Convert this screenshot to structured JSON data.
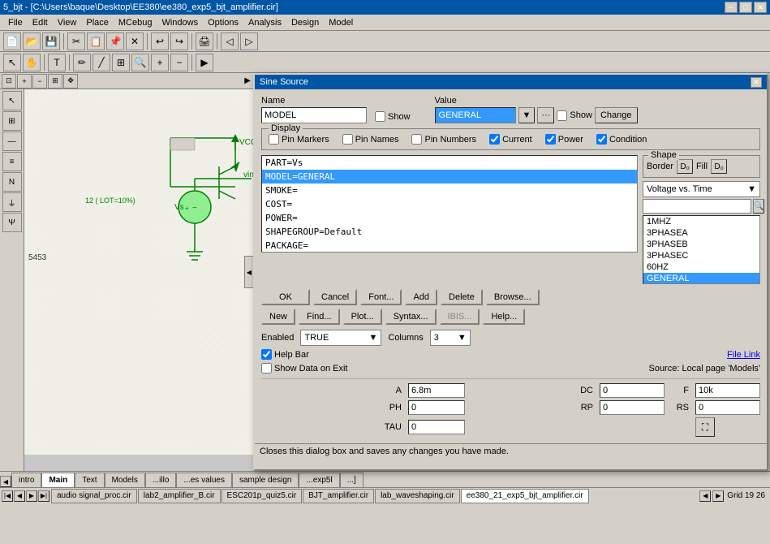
{
  "titleBar": {
    "text": "5_bjt - [C:\\Users\\baque\\Desktop\\EE380\\ee380_exp5_bjt_amplifier.cir]",
    "closeBtn": "✕",
    "minBtn": "−",
    "maxBtn": "□"
  },
  "menuBar": {
    "items": [
      "File",
      "Edit",
      "View",
      "Place",
      "MCebug",
      "Windows",
      "Options",
      "Analysis",
      "Design",
      "Model"
    ]
  },
  "dialog": {
    "title": "Sine Source",
    "name": {
      "label": "Name",
      "value": "MODEL"
    },
    "value": {
      "label": "Value",
      "value": "GENERAL",
      "showCheck": "Show",
      "changeBtn": "Change"
    },
    "display": {
      "legend": "Display",
      "options": [
        "Pin Markers",
        "Pin Names",
        "Pin Numbers",
        "Current",
        "Power",
        "Condition"
      ]
    },
    "shape": {
      "legend": "Shape",
      "borderLabel": "Border",
      "fillLabel": "Fill"
    },
    "properties": [
      {
        "text": "PART=Vs",
        "selected": false
      },
      {
        "text": "MODEL=GENERAL",
        "selected": true
      },
      {
        "text": "SMOKE=",
        "selected": false
      },
      {
        "text": "COST=",
        "selected": false
      },
      {
        "text": "POWER=",
        "selected": false
      },
      {
        "text": "SHAPEGROUP=Default",
        "selected": false
      },
      {
        "text": "PACKAGE=",
        "selected": false
      }
    ],
    "waveformLabel": "Voltage vs. Time",
    "waveforms": [
      {
        "name": "1MHZ",
        "selected": false
      },
      {
        "name": "3PHASEA",
        "selected": false
      },
      {
        "name": "3PHASEB",
        "selected": false
      },
      {
        "name": "3PHASEC",
        "selected": false
      },
      {
        "name": "60HZ",
        "selected": false
      },
      {
        "name": "GENERAL",
        "selected": true
      }
    ],
    "buttons": {
      "ok": "OK",
      "cancel": "Cancel",
      "font": "Font...",
      "add": "Add",
      "delete": "Delete",
      "browse": "Browse...",
      "new": "New",
      "find": "Find...",
      "plot": "Plot...",
      "syntax": "Syntax...",
      "ibis": "IBIS...",
      "help": "Help..."
    },
    "enabled": {
      "label": "Enabled",
      "value": "TRUE"
    },
    "columns": {
      "label": "Columns",
      "value": "3"
    },
    "helpBar": "Help Bar",
    "fileLink": "File Link",
    "showDataOnExit": "Show Data on Exit",
    "sourceText": "Source: Local page 'Models'",
    "params": {
      "A": {
        "label": "A",
        "value": "6.8m"
      },
      "PH": {
        "label": "PH",
        "value": "0"
      },
      "TAU": {
        "label": "TAU",
        "value": "0"
      },
      "DC": {
        "label": "DC",
        "value": "0"
      },
      "RP": {
        "label": "RP",
        "value": "0"
      },
      "F": {
        "label": "F",
        "value": "10k"
      },
      "RS": {
        "label": "RS",
        "value": "0"
      }
    }
  },
  "statusBar": {
    "message": "Closes this dialog box and saves any changes you have made."
  },
  "tabs": {
    "items": [
      "intro",
      "Main",
      "Text",
      "Models",
      "...illo",
      "...es values",
      "sample design",
      "...exp5l",
      "...]"
    ]
  },
  "footer": {
    "fileTabs": [
      "audio signal_proc.cir",
      "lab2_amplifier_B.cir",
      "ESC201p_quiz5.cir",
      "BJT_amplifier.cir",
      "lab_waveshaping.cir",
      "ee380_21_exp5_bjt_amplifier.cir"
    ],
    "gridText": "Grid 19 26"
  },
  "schematic": {
    "label1": "12 ( LOT=10%)",
    "label2": "VCC",
    "label3": "vin",
    "label4": "Vs",
    "value1": "5453"
  }
}
